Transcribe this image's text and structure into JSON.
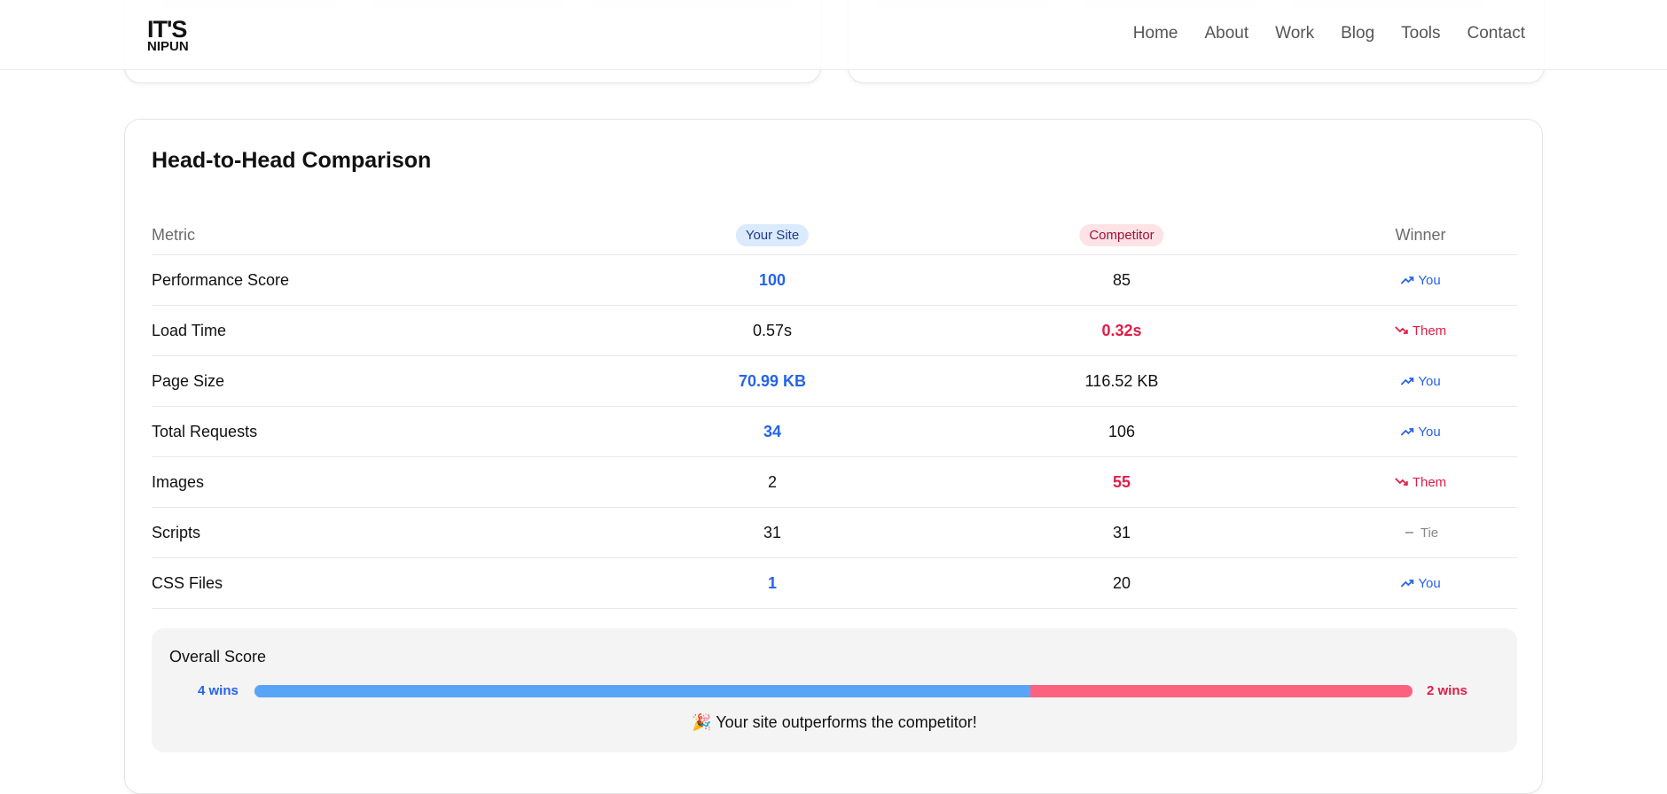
{
  "header": {
    "logo_line1": "IT'S",
    "logo_line2": "NIPUN",
    "nav": [
      "Home",
      "About",
      "Work",
      "Blog",
      "Tools",
      "Contact"
    ]
  },
  "comparison": {
    "title": "Head-to-Head Comparison",
    "columns": {
      "metric": "Metric",
      "you": "Your Site",
      "competitor": "Competitor",
      "winner": "Winner"
    },
    "rows": [
      {
        "metric": "Performance Score",
        "you": "100",
        "competitor": "85",
        "winner": "You"
      },
      {
        "metric": "Load Time",
        "you": "0.57s",
        "competitor": "0.32s",
        "winner": "Them"
      },
      {
        "metric": "Page Size",
        "you": "70.99 KB",
        "competitor": "116.52 KB",
        "winner": "You"
      },
      {
        "metric": "Total Requests",
        "you": "34",
        "competitor": "106",
        "winner": "You"
      },
      {
        "metric": "Images",
        "you": "2",
        "competitor": "55",
        "winner": "Them"
      },
      {
        "metric": "Scripts",
        "you": "31",
        "competitor": "31",
        "winner": "Tie"
      },
      {
        "metric": "CSS Files",
        "you": "1",
        "competitor": "20",
        "winner": "You"
      }
    ]
  },
  "overall": {
    "title": "Overall Score",
    "you_wins": "4 wins",
    "them_wins": "2 wins",
    "you_share": 0.67,
    "message": "Your site outperforms the competitor!",
    "message_icon": "🎉"
  },
  "colors": {
    "you": "#2563eb",
    "them": "#e11d48",
    "bar_you": "#58a4f7",
    "bar_them": "#fb6280"
  }
}
